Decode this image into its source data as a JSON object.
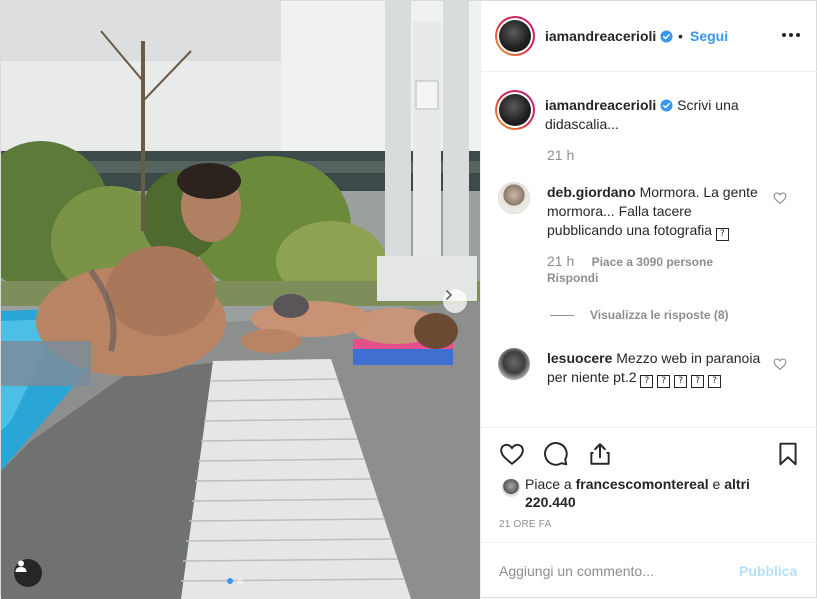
{
  "post": {
    "username": "iamandreacerioli",
    "follow_label": "Segui",
    "separator": "•",
    "caption": "Scrivi una didascalia...",
    "caption_time": "21 h"
  },
  "comments": [
    {
      "username": "deb.giordano",
      "text": "Mormora. La gente mormora... Falla tacere pubblicando una fotografia",
      "emoji": "?",
      "time": "21 h",
      "likes": "Piace a 3090 persone",
      "reply_label": "Rispondi",
      "view_replies": "Visualizza le risposte (8)"
    },
    {
      "username": "lesuocere",
      "text": "Mezzo web in paranoia per niente pt.2",
      "emoji": "?"
    }
  ],
  "likes": {
    "prefix": "Piace a",
    "user": "francescomontereal",
    "conjunction": "e",
    "others": "altri 220.440"
  },
  "time_ago": "21 ORE FA",
  "add_comment": {
    "placeholder": "Aggiungi un commento...",
    "publish_label": "Pubblica"
  },
  "colors": {
    "link_blue": "#3897f0",
    "publish_disabled": "#b2dffc",
    "muted": "#8e8e8e",
    "text": "#262626"
  },
  "icons": [
    "verified-badge-icon",
    "more-options-icon",
    "heart-icon",
    "comment-icon",
    "share-icon",
    "bookmark-icon",
    "next-arrow-icon",
    "user-tag-icon"
  ]
}
